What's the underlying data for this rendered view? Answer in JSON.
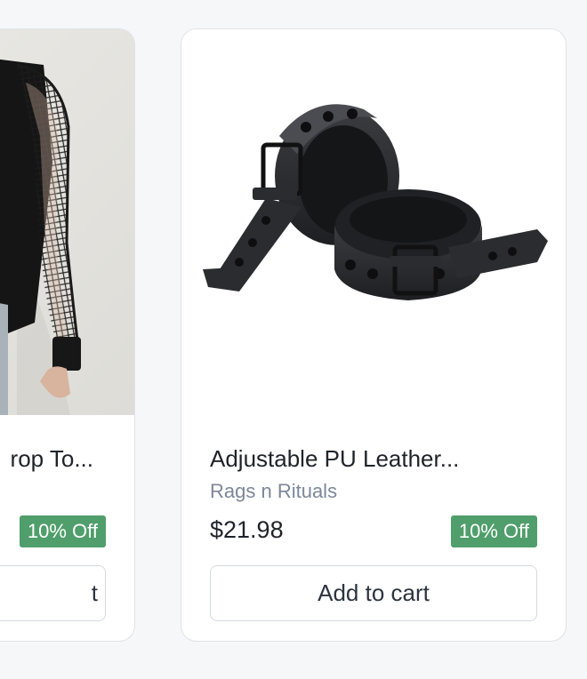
{
  "products": [
    {
      "title": "rop To...",
      "badge": "10% Off",
      "button_label": "t"
    },
    {
      "title": "Adjustable PU Leather...",
      "brand": "Rags n Rituals",
      "price": "$21.98",
      "badge": "10% Off",
      "button_label": "Add to cart"
    }
  ],
  "colors": {
    "badge_bg": "#4f9e6b",
    "brand_text": "#7c8799",
    "card_border": "#dfe2e7",
    "page_bg": "#f6f7f9"
  },
  "icons": [
    "fishnet-top-model-photo",
    "leather-cuffs-product-photo"
  ]
}
